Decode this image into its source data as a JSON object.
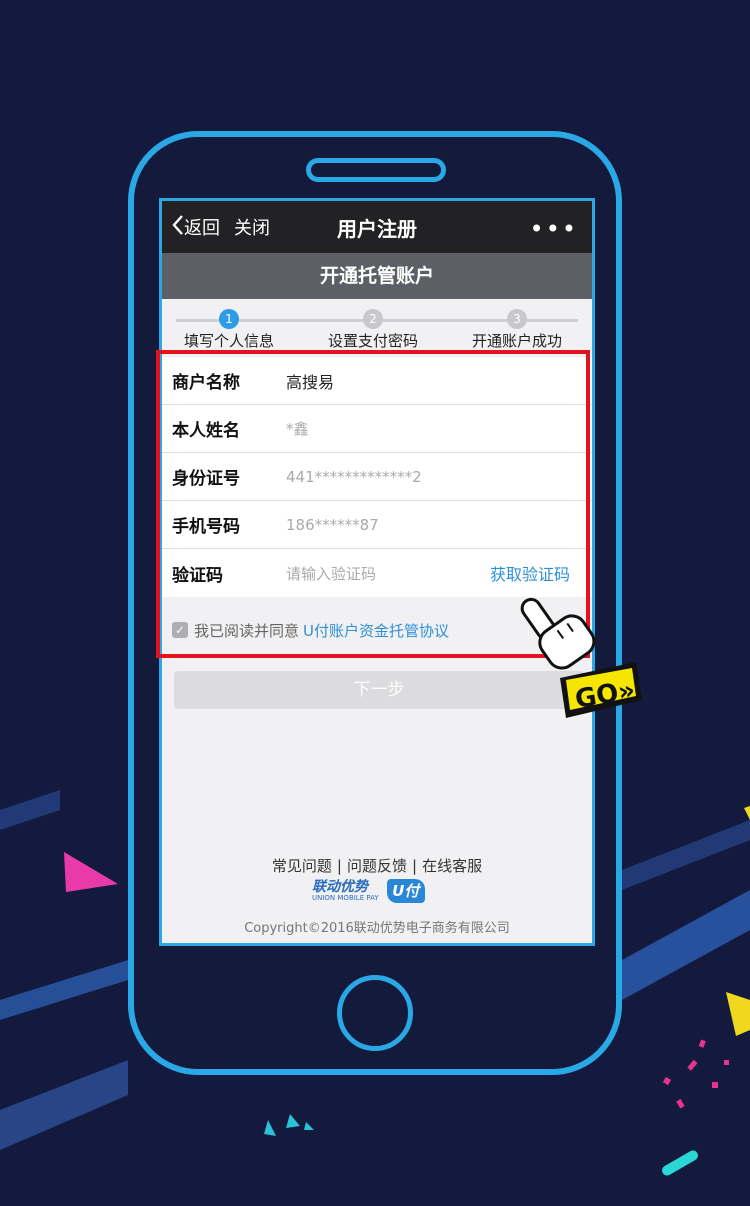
{
  "navbar": {
    "back_label": "返回",
    "close_label": "关闭",
    "title": "用户注册",
    "more_label": "•••"
  },
  "subheader": {
    "title": "开通托管账户"
  },
  "steps": [
    {
      "number": "1",
      "label": "填写个人信息",
      "active": true
    },
    {
      "number": "2",
      "label": "设置支付密码",
      "active": false
    },
    {
      "number": "3",
      "label": "开通账户成功",
      "active": false
    }
  ],
  "form": {
    "merchant": {
      "label": "商户名称",
      "value": "高搜易"
    },
    "name": {
      "label": "本人姓名",
      "value": "*鑫"
    },
    "id": {
      "label": "身份证号",
      "value": "441*************2"
    },
    "phone": {
      "label": "手机号码",
      "value": "186******87"
    },
    "code": {
      "label": "验证码",
      "placeholder": "请输入验证码",
      "action": "获取验证码"
    }
  },
  "agreement": {
    "text": "我已阅读并同意",
    "link": "U付账户资金托管协议",
    "checked": true
  },
  "next_button": "下一步",
  "footer": {
    "links": [
      "常见问题",
      "问题反馈",
      "在线客服"
    ],
    "brand_cn": "联动优势",
    "brand_en": "UNION MOBILE PAY",
    "brand_badge": "U付",
    "copyright": "Copyright©2016联动优势电子商务有限公司"
  },
  "go_badge": "GO»",
  "colors": {
    "background": "#141a3e",
    "phone_frame": "#2aa8e6",
    "accent_blue": "#2e8fd8",
    "highlight_red": "#e0141c",
    "go_yellow": "#f5e600"
  }
}
